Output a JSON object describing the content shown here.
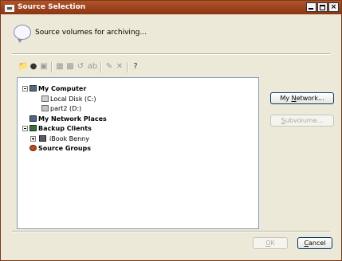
{
  "window": {
    "title": "Source Selection"
  },
  "header": {
    "text": "Source volumes for archiving..."
  },
  "toolbar": {
    "icons": [
      "new-folder-icon",
      "open-icon",
      "drive-icon",
      "properties-icon",
      "settings-icon",
      "rename-icon",
      "label-icon",
      "comment-icon",
      "delete-icon",
      "help-icon"
    ]
  },
  "tree": {
    "my_computer": "My Computer",
    "local_disk": "Local Disk (C:)",
    "part2": "part2 (D:)",
    "my_network_places": "My Network Places",
    "backup_clients": "Backup Clients",
    "ibook_benny": "iBook Benny",
    "source_groups": "Source Groups"
  },
  "buttons": {
    "my_network_prefix": "My ",
    "my_network_hotkey": "N",
    "my_network_suffix": "etwork...",
    "subvolume_hotkey": "S",
    "subvolume_suffix": "ubvolume...",
    "ok_hotkey": "O",
    "ok_suffix": "K",
    "cancel_hotkey": "C",
    "cancel_suffix": "ancel"
  },
  "colors": {
    "titlebar": "#8a3513",
    "window_bg": "#ece9d8",
    "tree_border": "#7f9db9"
  }
}
